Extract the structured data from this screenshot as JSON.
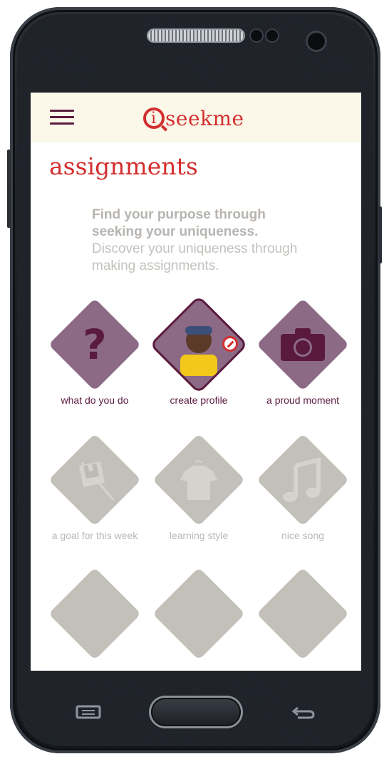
{
  "app": {
    "logo_text": "seekme",
    "logo_letter": "i",
    "brand_color": "#d32f2f",
    "accent_color": "#5a1a3e",
    "menu_icon": "hamburger-menu-icon"
  },
  "page": {
    "title": "assignments",
    "intro_bold": "Find your purpose through seeking your uniqueness.",
    "intro_rest": " Discover your uniqueness through making assignments."
  },
  "assignments": [
    {
      "label": "what do you do",
      "icon": "question-mark-icon",
      "state": "active"
    },
    {
      "label": "create profile",
      "icon": "profile-photo",
      "state": "active"
    },
    {
      "label": "a proud moment",
      "icon": "camera-icon",
      "state": "active"
    },
    {
      "label": "a goal for this week",
      "icon": "checkered-flag-icon",
      "state": "inactive"
    },
    {
      "label": "learning style",
      "icon": "shirt-icon",
      "state": "inactive"
    },
    {
      "label": "nice song",
      "icon": "music-note-icon",
      "state": "inactive"
    },
    {
      "label": "",
      "icon": "",
      "state": "inactive"
    },
    {
      "label": "",
      "icon": "",
      "state": "inactive"
    },
    {
      "label": "",
      "icon": "",
      "state": "inactive"
    }
  ],
  "colors": {
    "active_tile": "#8c6a86",
    "inactive_tile": "#c3c0b9",
    "header_bg": "#fbf7e9"
  }
}
